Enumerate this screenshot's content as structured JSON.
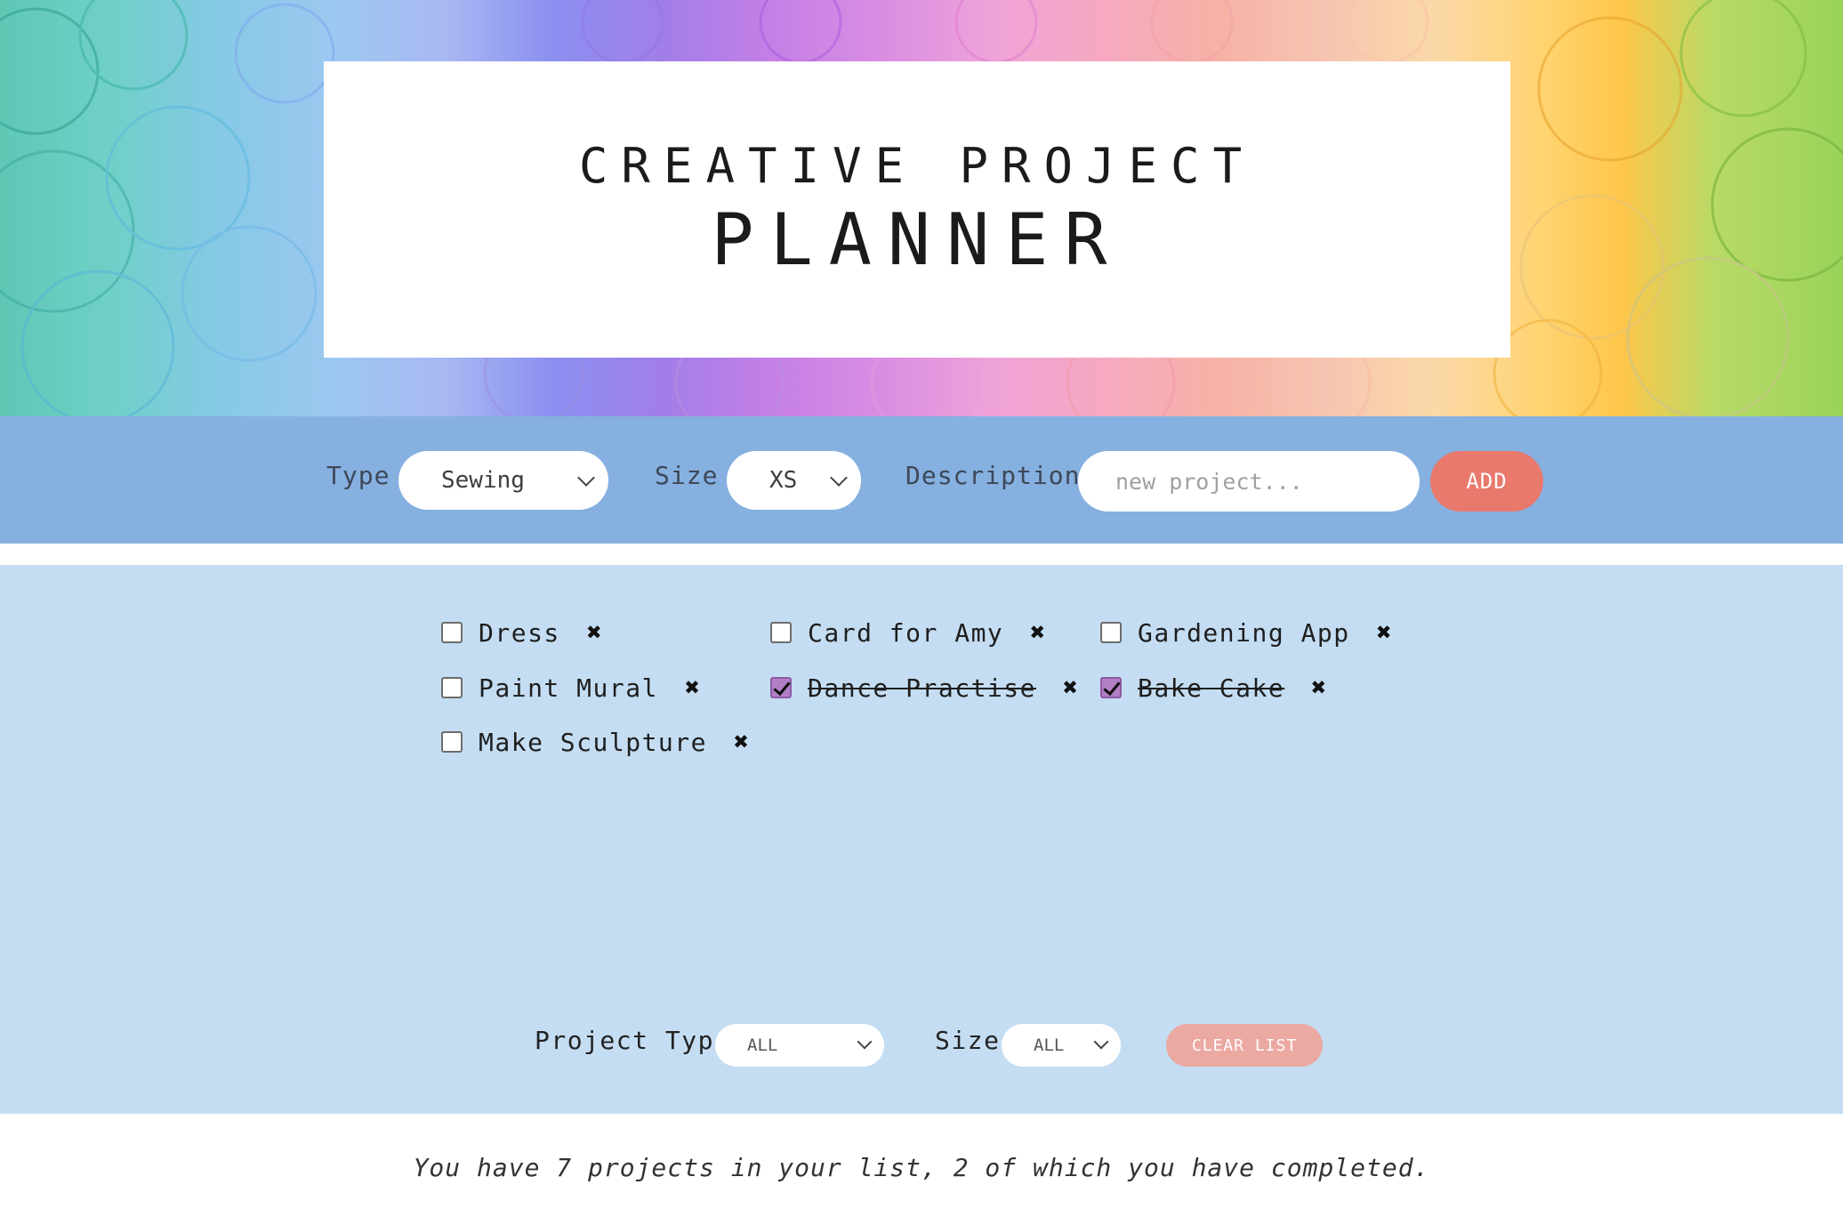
{
  "header": {
    "title_line1": "CREATIVE PROJECT",
    "title_line2": "PLANNER"
  },
  "add_form": {
    "type_label": "Type",
    "type_value": "Sewing",
    "size_label": "Size",
    "size_value": "XS",
    "description_label": "Description",
    "description_placeholder": "new project...",
    "add_button": "ADD"
  },
  "projects": [
    {
      "label": "Dress",
      "completed": false
    },
    {
      "label": "Card for Amy",
      "completed": false
    },
    {
      "label": "Gardening App",
      "completed": false
    },
    {
      "label": "Paint Mural",
      "completed": false
    },
    {
      "label": "Dance Practise",
      "completed": true
    },
    {
      "label": "Bake Cake",
      "completed": true
    },
    {
      "label": "Make Sculpture",
      "completed": false
    }
  ],
  "delete_glyph": "✖",
  "filters": {
    "project_type_label": "Project Type",
    "project_type_value": "ALL",
    "size_label": "Size",
    "size_value": "ALL",
    "clear_button": "CLEAR LIST"
  },
  "summary": "You have 7 projects in your list, 2 of which you have completed.",
  "colors": {
    "add_bar": "#86b0e0",
    "list_panel": "#c4ddf2",
    "add_button": "#e8796c",
    "clear_button": "#eba9a2",
    "checkbox_checked": "#b27fc6"
  }
}
